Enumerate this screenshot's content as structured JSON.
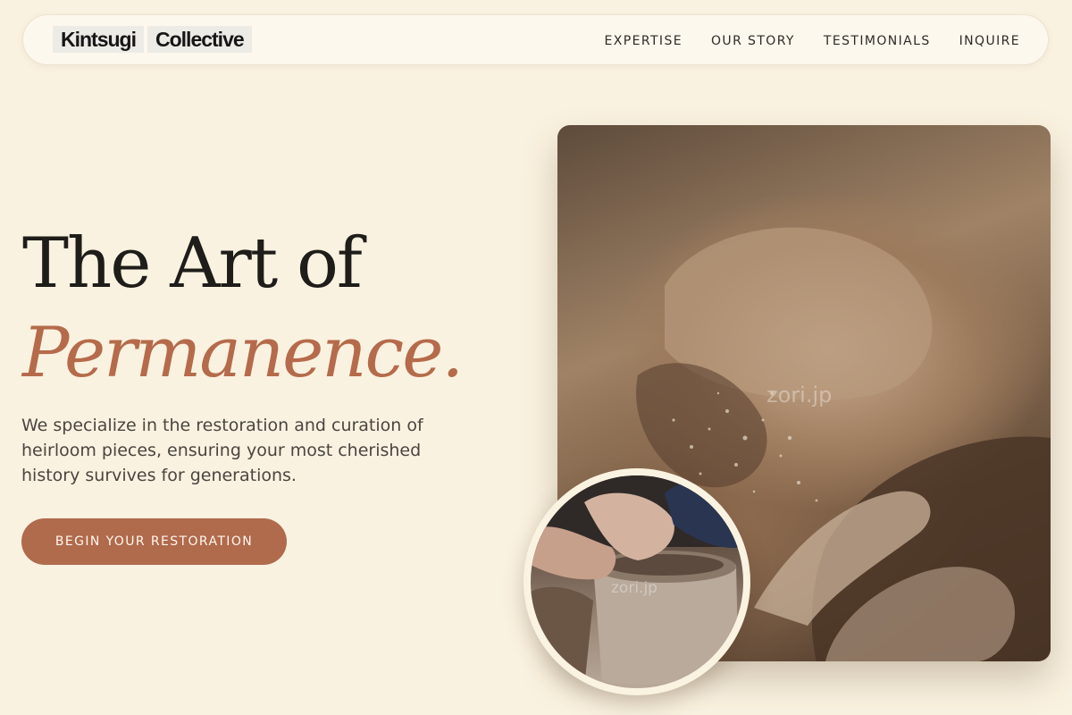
{
  "brand": {
    "word1": "Kintsugi",
    "word2": "Collective"
  },
  "nav": {
    "links": [
      "EXPERTISE",
      "OUR STORY",
      "TESTIMONIALS",
      "INQUIRE"
    ]
  },
  "hero": {
    "title_line1": "The Art of",
    "title_line2": "Permanence.",
    "description": "We specialize in the restoration and curation of heirloom pieces, ensuring your most cherished history survives for generations.",
    "cta_label": "BEGIN YOUR RESTORATION"
  },
  "images": {
    "main_watermark": "zori.jp",
    "circle_watermark": "zori.jp"
  },
  "colors": {
    "background": "#faf2e0",
    "accent": "#b06a4c",
    "accent_text": "#b56b4b",
    "heading": "#1f1d1a"
  }
}
